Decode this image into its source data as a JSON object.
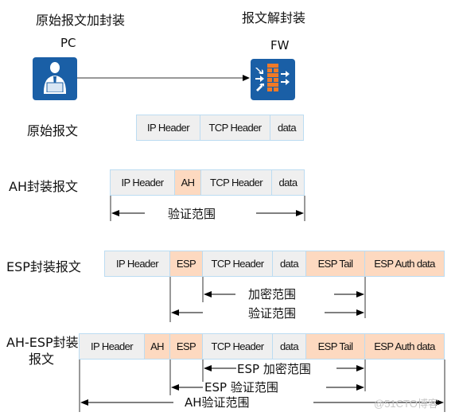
{
  "titles": {
    "left": "原始报文加封装",
    "right": "报文解封装"
  },
  "nodes": {
    "pc": {
      "label": "PC",
      "icon": "pc-user-icon",
      "color": "#1a5fa6"
    },
    "fw": {
      "label": "FW",
      "icon": "firewall-icon",
      "color": "#1a5fa6",
      "brick_color": "#f07a28"
    }
  },
  "colors": {
    "plain_field": "#efefef",
    "security_field": "#fdd9c0",
    "field_border": "#bcdcf2"
  },
  "packets": [
    {
      "label": "原始报文",
      "fields": [
        {
          "name": "IP Header",
          "type": "plain"
        },
        {
          "name": "TCP Header",
          "type": "plain"
        },
        {
          "name": "data",
          "type": "plain"
        }
      ],
      "ranges": []
    },
    {
      "label": "AH封装报文",
      "fields": [
        {
          "name": "IP Header",
          "type": "plain"
        },
        {
          "name": "AH",
          "type": "sec"
        },
        {
          "name": "TCP Header",
          "type": "plain"
        },
        {
          "name": "data",
          "type": "plain"
        }
      ],
      "ranges": [
        {
          "label": "验证范围",
          "from": "IP Header",
          "to": "data"
        }
      ]
    },
    {
      "label": "ESP封装报文",
      "fields": [
        {
          "name": "IP Header",
          "type": "plain"
        },
        {
          "name": "ESP",
          "type": "sec"
        },
        {
          "name": "TCP Header",
          "type": "plain"
        },
        {
          "name": "data",
          "type": "plain"
        },
        {
          "name": "ESP Tail",
          "type": "sec"
        },
        {
          "name": "ESP Auth data",
          "type": "sec"
        }
      ],
      "ranges": [
        {
          "label": "加密范围",
          "from": "TCP Header",
          "to": "ESP Tail"
        },
        {
          "label": "验证范围",
          "from": "ESP",
          "to": "ESP Tail"
        }
      ]
    },
    {
      "label_line1": "AH-ESP封装",
      "label_line2": "报文",
      "fields": [
        {
          "name": "IP Header",
          "type": "plain"
        },
        {
          "name": "AH",
          "type": "plain_sec"
        },
        {
          "name": "ESP",
          "type": "sec"
        },
        {
          "name": "TCP Header",
          "type": "plain"
        },
        {
          "name": "data",
          "type": "plain"
        },
        {
          "name": "ESP Tail",
          "type": "sec"
        },
        {
          "name": "ESP Auth data",
          "type": "sec"
        }
      ],
      "ranges": [
        {
          "label": "ESP 加密范围",
          "from": "TCP Header",
          "to": "ESP Tail"
        },
        {
          "label": "ESP 验证范围",
          "from": "ESP",
          "to": "ESP Tail"
        },
        {
          "label": "AH验证范围",
          "from": "IP Header",
          "to": "ESP Auth data"
        }
      ]
    }
  ],
  "watermark": "@51CTO博客"
}
